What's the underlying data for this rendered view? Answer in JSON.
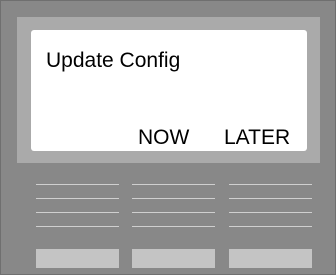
{
  "display": {
    "title": "Update Config",
    "softkeys": [
      {
        "label": "NOW"
      },
      {
        "label": "LATER"
      }
    ]
  },
  "colors": {
    "body": "#888888",
    "bezel": "#aaaaaa",
    "screen": "#ffffff",
    "grille_lines": "#cfcfcf",
    "hardware_buttons": "#c4c4c4"
  }
}
